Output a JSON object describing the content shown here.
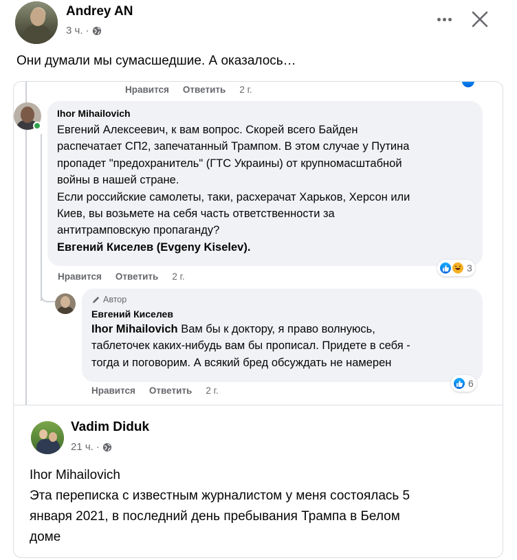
{
  "post": {
    "author": "Andrey AN",
    "time": "3 ч.",
    "separator": "·",
    "text": "Они думали мы сумасшедшие.  А оказалось…"
  },
  "shared": {
    "top_actions": {
      "like": "Нравится",
      "reply": "Ответить",
      "time": "2 г."
    },
    "comment1": {
      "author": "Ihor Mihailovich",
      "lines": [
        "Евгений Алексеевич, к вам вопрос. Скорей всего Байден",
        "распечатает СП2, запечатанный Трампом. В этом случае у Путина",
        "пропадет \"предохранитель\" (ГТС Украины) от крупномасштабной",
        "войны в нашей стране.",
        "Если российские самолеты, таки, расхерачат Харьков, Херсон или",
        "Киев, вы возьмете на себя часть ответственности за",
        "антитрамповскую пропаганду?"
      ],
      "mention": "Евгений Киселев (Evgeny Kiselev).",
      "reactions_count": "3",
      "actions": {
        "like": "Нравится",
        "reply": "Ответить",
        "time": "2 г."
      }
    },
    "reply1": {
      "badge": "Автор",
      "author": "Евгений Киселев",
      "mention": "Ihor Mihailovich",
      "line1_rest": " Вам бы к доктору, я право волнуюсь,",
      "line2": "таблеточек каких-нибудь вам бы прописал. Придете в себя -",
      "line3": "тогда и поговорим. А всякий бред обсуждать не намерен",
      "reactions_count": "6",
      "actions": {
        "like": "Нравится",
        "reply": "Ответить",
        "time": "2 г."
      }
    },
    "post2": {
      "author": "Vadim Diduk",
      "time": "21 ч.",
      "separator": "·",
      "lines": [
        "Ihor Mihailovich",
        "Эта переписка с известным журналистом у меня состоялась 5",
        "января 2021, в последний день пребывания Трампа в Белом",
        "доме"
      ]
    }
  },
  "colors": {
    "text": "#050505",
    "secondary": "#65676b",
    "bubble": "#f0f2f5",
    "like_blue": "#0866ff",
    "online": "#31a24c"
  },
  "icons": [
    "globe-icon",
    "more-icon",
    "close-icon",
    "like-reaction-icon",
    "haha-reaction-icon",
    "pencil-icon"
  ]
}
